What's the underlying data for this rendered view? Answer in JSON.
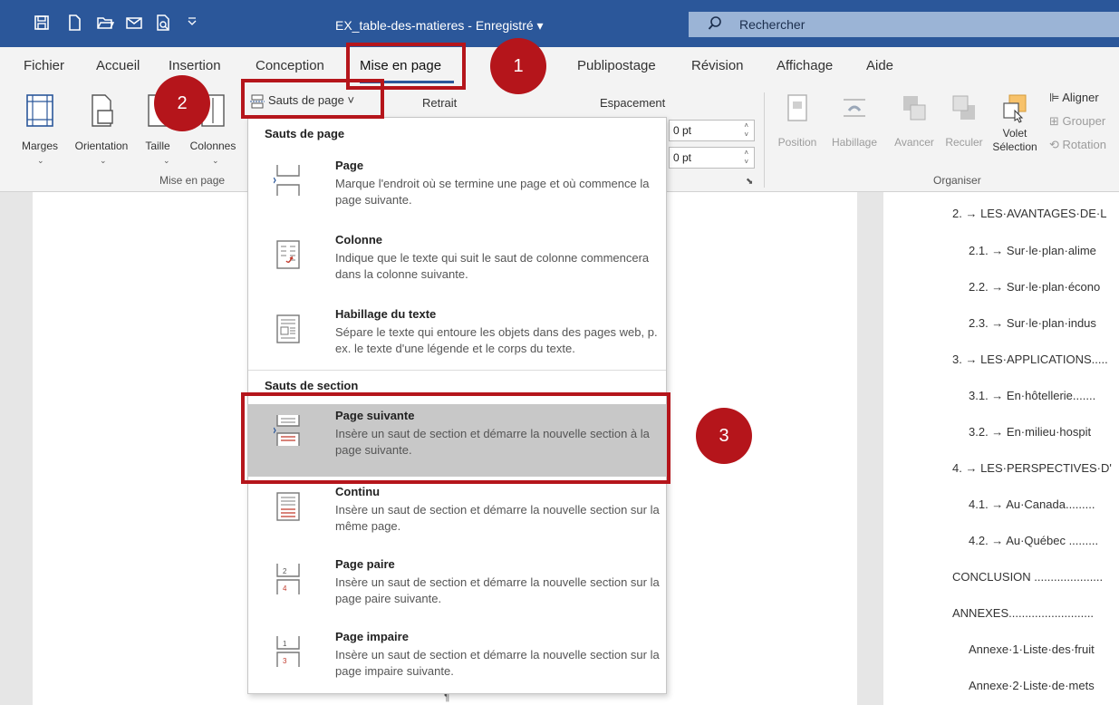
{
  "window": {
    "doc_title": "EX_table-des-matieres - Enregistré ▾",
    "search_placeholder": "Rechercher"
  },
  "quick_access": [
    "autosave-icon",
    "new-document-icon",
    "open-folder-icon",
    "email-icon",
    "print-preview-icon",
    "customize-toolbar-icon"
  ],
  "tabs": [
    {
      "label": "Fichier"
    },
    {
      "label": "Accueil"
    },
    {
      "label": "Insertion"
    },
    {
      "label": "Conception"
    },
    {
      "label": "Mise en page",
      "active": true
    },
    {
      "label": "Publipostage"
    },
    {
      "label": "Révision"
    },
    {
      "label": "Affichage"
    },
    {
      "label": "Aide"
    }
  ],
  "ribbon": {
    "mise_en_page": {
      "marges": "Marges",
      "orientation": "Orientation",
      "taille": "Taille",
      "colonnes": "Colonnes",
      "sauts_de_page": "Sauts de page ˅",
      "group_label": "Mise en page"
    },
    "paragraphe": {
      "retrait": "Retrait",
      "espacement": "Espacement",
      "avant": "0 pt",
      "apres": "0 pt"
    },
    "organiser": {
      "position": "Position",
      "habillage": "Habillage",
      "avancer": "Avancer",
      "reculer": "Reculer",
      "volet_line1": "Volet",
      "volet_line2": "Sélection",
      "aligner": "Aligner",
      "grouper": "Grouper",
      "rotation": "Rotation",
      "group_label": "Organiser"
    }
  },
  "dropdown": {
    "header_page": "Sauts de page",
    "header_section": "Sauts de section",
    "items": [
      {
        "title": "Page",
        "desc": "Marque l'endroit où se termine une page et où commence la page suivante."
      },
      {
        "title": "Colonne",
        "desc": "Indique que le texte qui suit le saut de colonne commencera dans la colonne suivante."
      },
      {
        "title": "Habillage du texte",
        "desc": "Sépare le texte qui entoure les objets dans des pages web, p. ex. le texte d'une légende et le corps du texte."
      },
      {
        "title": "Page suivante",
        "desc": "Insère un saut de section et démarre la nouvelle section à la page suivante.",
        "highlighted": true
      },
      {
        "title": "Continu",
        "desc": "Insère un saut de section et démarre la nouvelle section sur la même page."
      },
      {
        "title": "Page paire",
        "desc": "Insère un saut de section et démarre la nouvelle section sur la page paire suivante."
      },
      {
        "title": "Page impaire",
        "desc": "Insère un saut de section et démarre la nouvelle section sur la page impaire suivante."
      }
    ]
  },
  "toc": [
    "2. → LES·AVANTAGES·DE·L",
    "2.1. → Sur·le·plan·alime",
    "2.2. → Sur·le·plan·écono",
    "2.3. → Sur·le·plan·indus",
    "3. → LES·APPLICATIONS.....",
    "3.1. → En·hôtellerie.......",
    "3.2. → En·milieu·hospit",
    "4. → LES·PERSPECTIVES·D'",
    "4.1. → Au·Canada.........",
    "4.2. → Au·Québec .........",
    "CONCLUSION .....................",
    "ANNEXES..........................",
    "Annexe·1·Liste·des·fruit",
    "Annexe·2·Liste·de·mets"
  ],
  "pilcrow": "¶",
  "annotations": [
    "1",
    "2",
    "3"
  ],
  "colors": {
    "titlebar": "#2b579a",
    "callout": "#b5151b",
    "highlight": "#c8c8c8"
  }
}
